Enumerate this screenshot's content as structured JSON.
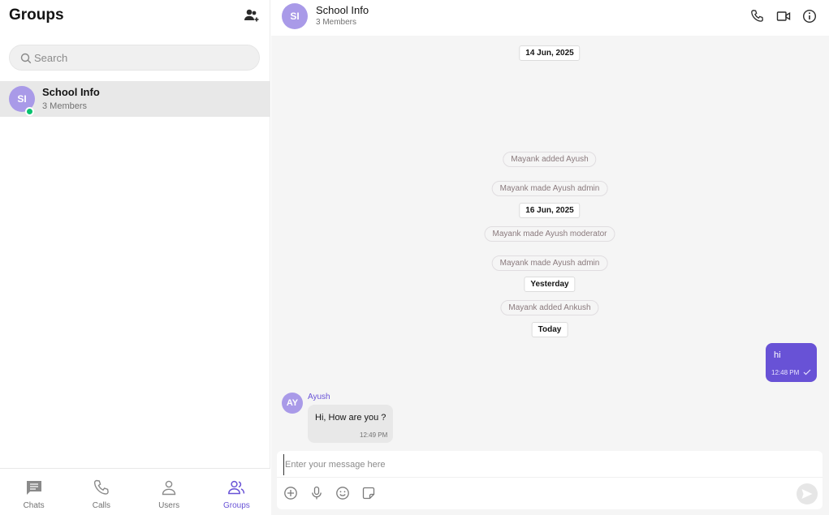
{
  "sidebar": {
    "title": "Groups",
    "search_placeholder": "Search",
    "conversation": {
      "initials": "SI",
      "name": "School Info",
      "subtitle": "3 Members"
    },
    "nav": [
      {
        "label": "Chats",
        "icon": "chat-icon"
      },
      {
        "label": "Calls",
        "icon": "phone-icon"
      },
      {
        "label": "Users",
        "icon": "user-icon"
      },
      {
        "label": "Groups",
        "icon": "group-icon"
      }
    ],
    "active_nav": "Groups"
  },
  "header": {
    "initials": "SI",
    "name": "School Info",
    "subtitle": "3 Members"
  },
  "messages": {
    "date_1": "14 Jun, 2025",
    "action_1": "Mayank added Ayush",
    "action_2": "Mayank made Ayush admin",
    "date_2": "16 Jun, 2025",
    "action_3": "Mayank made Ayush moderator",
    "action_4": "Mayank made Ayush admin",
    "date_3": "Yesterday",
    "action_5": "Mayank added Ankush",
    "date_4": "Today",
    "outgoing": {
      "text": "hi",
      "time": "12:48 PM"
    },
    "incoming": {
      "initials": "AY",
      "sender": "Ayush",
      "text": "Hi, How are you ?",
      "time": "12:49 PM"
    }
  },
  "composer": {
    "placeholder": "Enter your message here"
  },
  "colors": {
    "accent": "#6852d6",
    "avatar": "#a99ae8",
    "online": "#09c26f"
  }
}
